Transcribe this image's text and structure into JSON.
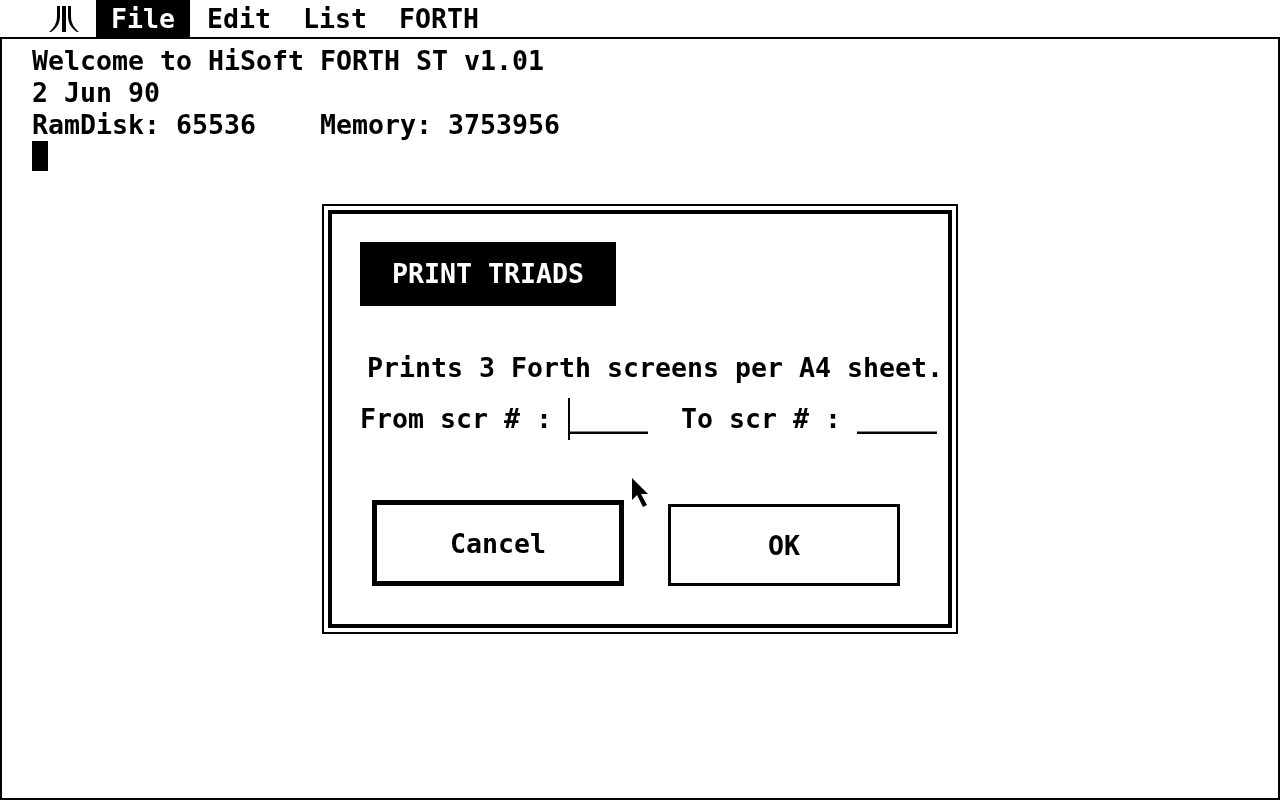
{
  "menu_bar": {
    "items": [
      {
        "label": "File",
        "selected": true
      },
      {
        "label": "Edit",
        "selected": false
      },
      {
        "label": "List",
        "selected": false
      },
      {
        "label": "FORTH",
        "selected": false
      }
    ]
  },
  "console": {
    "lines": [
      "Welcome to HiSoft FORTH ST v1.01",
      "2 Jun 90",
      "RamDisk: 65536    Memory: 3753956"
    ],
    "cursor": true
  },
  "dialog": {
    "title": "PRINT TRIADS",
    "message": "Prints 3 Forth screens per A4 sheet.",
    "fields": [
      {
        "label": "From scr # :",
        "blank": "_____",
        "focused": true
      },
      {
        "label": "To scr # :",
        "blank": "_____",
        "focused": false
      }
    ],
    "buttons": [
      {
        "label": "Cancel",
        "default": true
      },
      {
        "label": "OK",
        "default": false
      }
    ]
  }
}
